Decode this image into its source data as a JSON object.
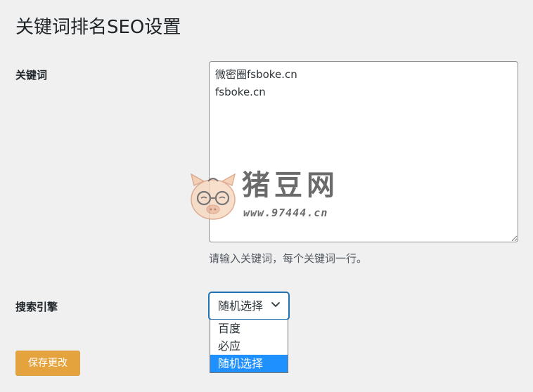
{
  "page": {
    "title": "关键词排名SEO设置"
  },
  "form": {
    "keywords": {
      "label": "关键词",
      "value": "微密圈fsboke.cn\nfsboke.cn",
      "helper": "请输入关键词，每个关键词一行。"
    },
    "engine": {
      "label": "搜索引擎",
      "selected": "随机选择",
      "options": [
        "百度",
        "必应",
        "随机选择"
      ]
    },
    "save_label": "保存更改"
  },
  "watermark": {
    "title": "猪豆网",
    "url": "www.97444.cn"
  },
  "colors": {
    "accent": "#2271b1",
    "save_button": "#e5a33e",
    "option_highlight": "#1e90ff"
  }
}
